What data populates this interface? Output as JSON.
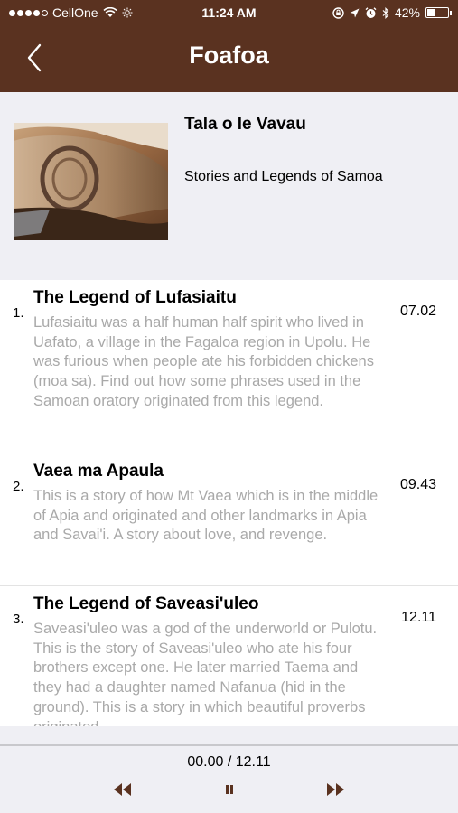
{
  "status_bar": {
    "carrier": "CellOne",
    "time": "11:24 AM",
    "battery_percent": "42%",
    "battery_level": 0.42,
    "icons": [
      "wifi-icon",
      "brightness-icon",
      "rotation-lock-icon",
      "location-arrow-icon",
      "alarm-icon",
      "bluetooth-icon",
      "battery-icon"
    ]
  },
  "nav": {
    "title": "Foafoa",
    "back_icon": "chevron-left-icon"
  },
  "album": {
    "title": "Tala o le Vavau",
    "subtitle": "Stories and Legends of Samoa"
  },
  "tracks": [
    {
      "number": "1.",
      "title": "The Legend of Lufasiaitu",
      "description": "Lufasiaitu was a half human half spirit who lived in Uafato, a village in the Fagaloa region in Upolu. He was furious when people ate his forbidden chickens (moa sa). Find out how some phrases used in the Samoan oratory originated from this legend.",
      "duration": "07.02"
    },
    {
      "number": "2.",
      "title": "Vaea ma Apaula",
      "description": "This is a story of how Mt Vaea which is in the middle of Apia and originated and other landmarks in Apia and Savai'i. A story about love, and revenge.",
      "duration": "09.43"
    },
    {
      "number": "3.",
      "title": "The Legend of Saveasi'uleo",
      "description": "Saveasi'uleo was a god of the underworld or Pulotu. This is the story of Saveasi'uleo who ate his four brothers except one. He later married Taema and they had a daughter named Nafanua (hid in the ground). This is a story in which beautiful proverbs originated.",
      "duration": "12.11"
    }
  ],
  "player": {
    "time": "00.00 / 12.11",
    "controls": [
      "rewind-icon",
      "pause-icon",
      "fast-forward-icon"
    ]
  },
  "colors": {
    "header": "#5a3220",
    "controls": "#5a3220",
    "description_text": "#a9a9a9",
    "background": "#efeff4"
  }
}
